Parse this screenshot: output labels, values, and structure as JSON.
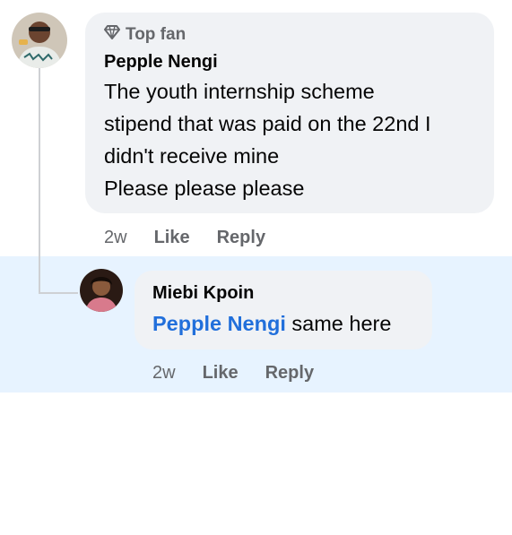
{
  "comment": {
    "badge_label": "Top fan",
    "badge_icon": "diamond-icon",
    "author": "Pepple Nengi",
    "lines": [
      "The youth internship scheme",
      "stipend that was paid on the 22nd I",
      "didn't receive mine",
      "Please please please"
    ],
    "time": "2w",
    "like_label": "Like",
    "reply_label": "Reply"
  },
  "reply": {
    "author": "Miebi Kpoin",
    "mention": "Pepple Nengi",
    "text": " same here",
    "time": "2w",
    "like_label": "Like",
    "reply_label": "Reply"
  },
  "colors": {
    "bubble": "#f0f2f5",
    "reply_highlight": "#e7f3ff",
    "mention": "#216fdb",
    "secondary_text": "#65676b"
  }
}
